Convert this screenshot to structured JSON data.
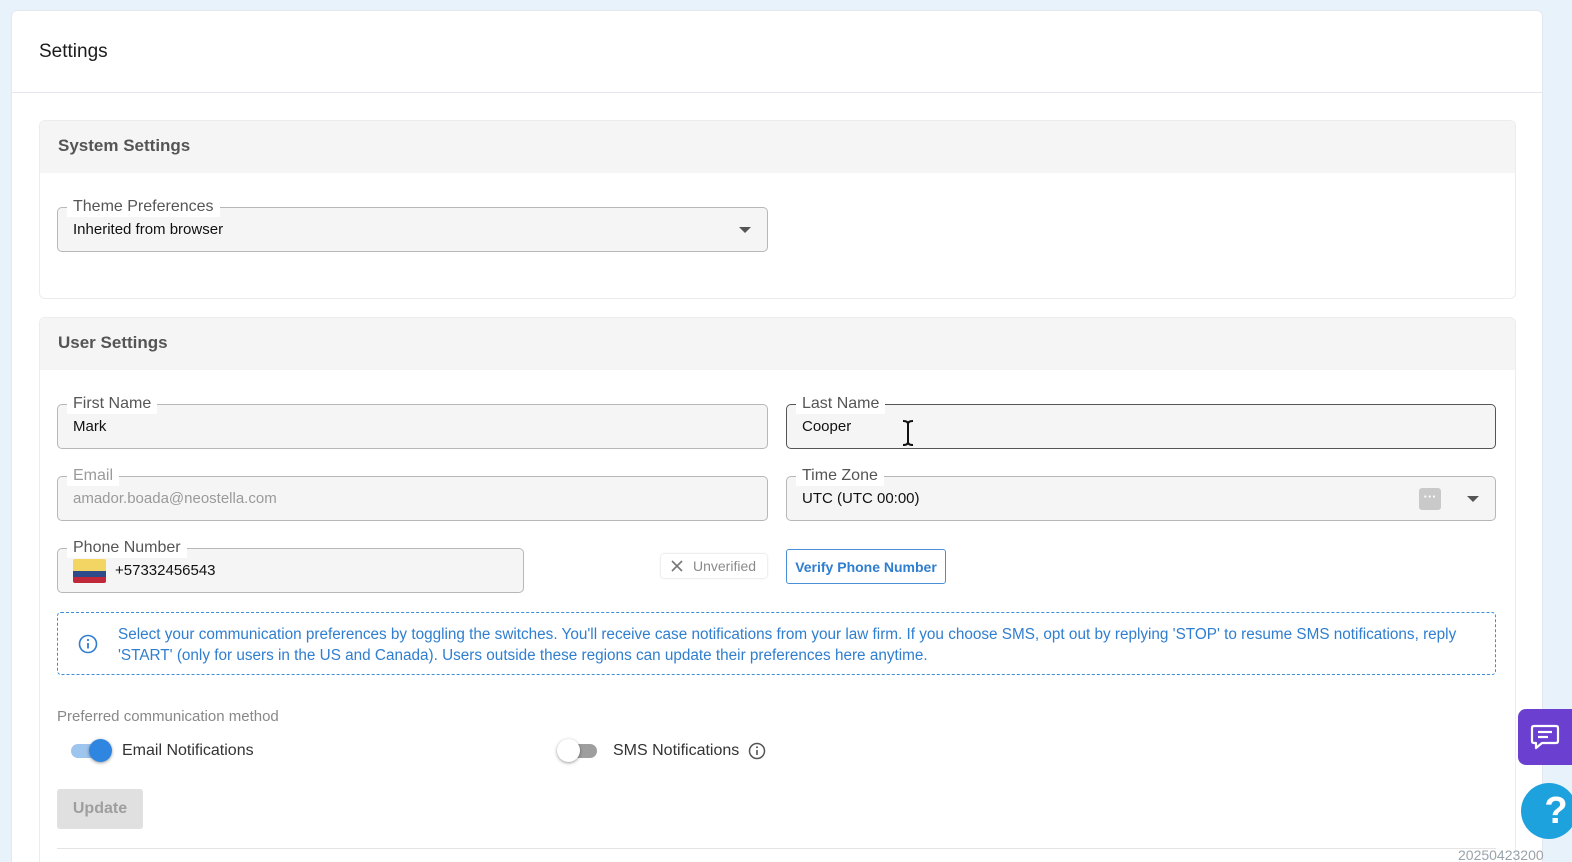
{
  "page": {
    "title": "Settings"
  },
  "system_settings": {
    "title": "System Settings",
    "theme": {
      "label": "Theme Preferences",
      "value": "Inherited from browser"
    }
  },
  "user_settings": {
    "title": "User Settings",
    "first_name": {
      "label": "First Name",
      "value": "Mark"
    },
    "last_name": {
      "label": "Last Name",
      "value": "Cooper"
    },
    "email": {
      "label": "Email",
      "value": "amador.boada@neostella.com"
    },
    "time_zone": {
      "label": "Time Zone",
      "value": "UTC (UTC 00:00)",
      "button_glyph": "···"
    },
    "phone": {
      "label": "Phone Number",
      "value": "+57332456543",
      "flag_colors": [
        "#f3d563",
        "#2f4a8a",
        "#c0283a"
      ],
      "status": "Unverified",
      "verify_label": "Verify Phone Number"
    },
    "notice": "Select your communication preferences by toggling the switches. You'll receive case notifications from your law firm. If you choose SMS, opt out by replying 'STOP' to resume SMS notifications, reply 'START' (only for users in the US and Canada). Users outside these regions can update their preferences here anytime.",
    "preferred_method_label": "Preferred communication method",
    "email_notifications": {
      "label": "Email Notifications",
      "enabled": true
    },
    "sms_notifications": {
      "label": "SMS Notifications",
      "enabled": false
    },
    "update_label": "Update"
  },
  "colors": {
    "accent": "#2f7ecf",
    "toggle_on_knob": "#2f86e0",
    "toggle_on_track": "#9ec5ee",
    "toggle_off_knob": "#ffffff",
    "toggle_off_track": "#9e9e9e",
    "chat": "#6b3fd0",
    "help": "#1ea2de"
  },
  "widgets": {
    "help_glyph": "?"
  },
  "footer": {
    "build_id": "20250423200"
  }
}
